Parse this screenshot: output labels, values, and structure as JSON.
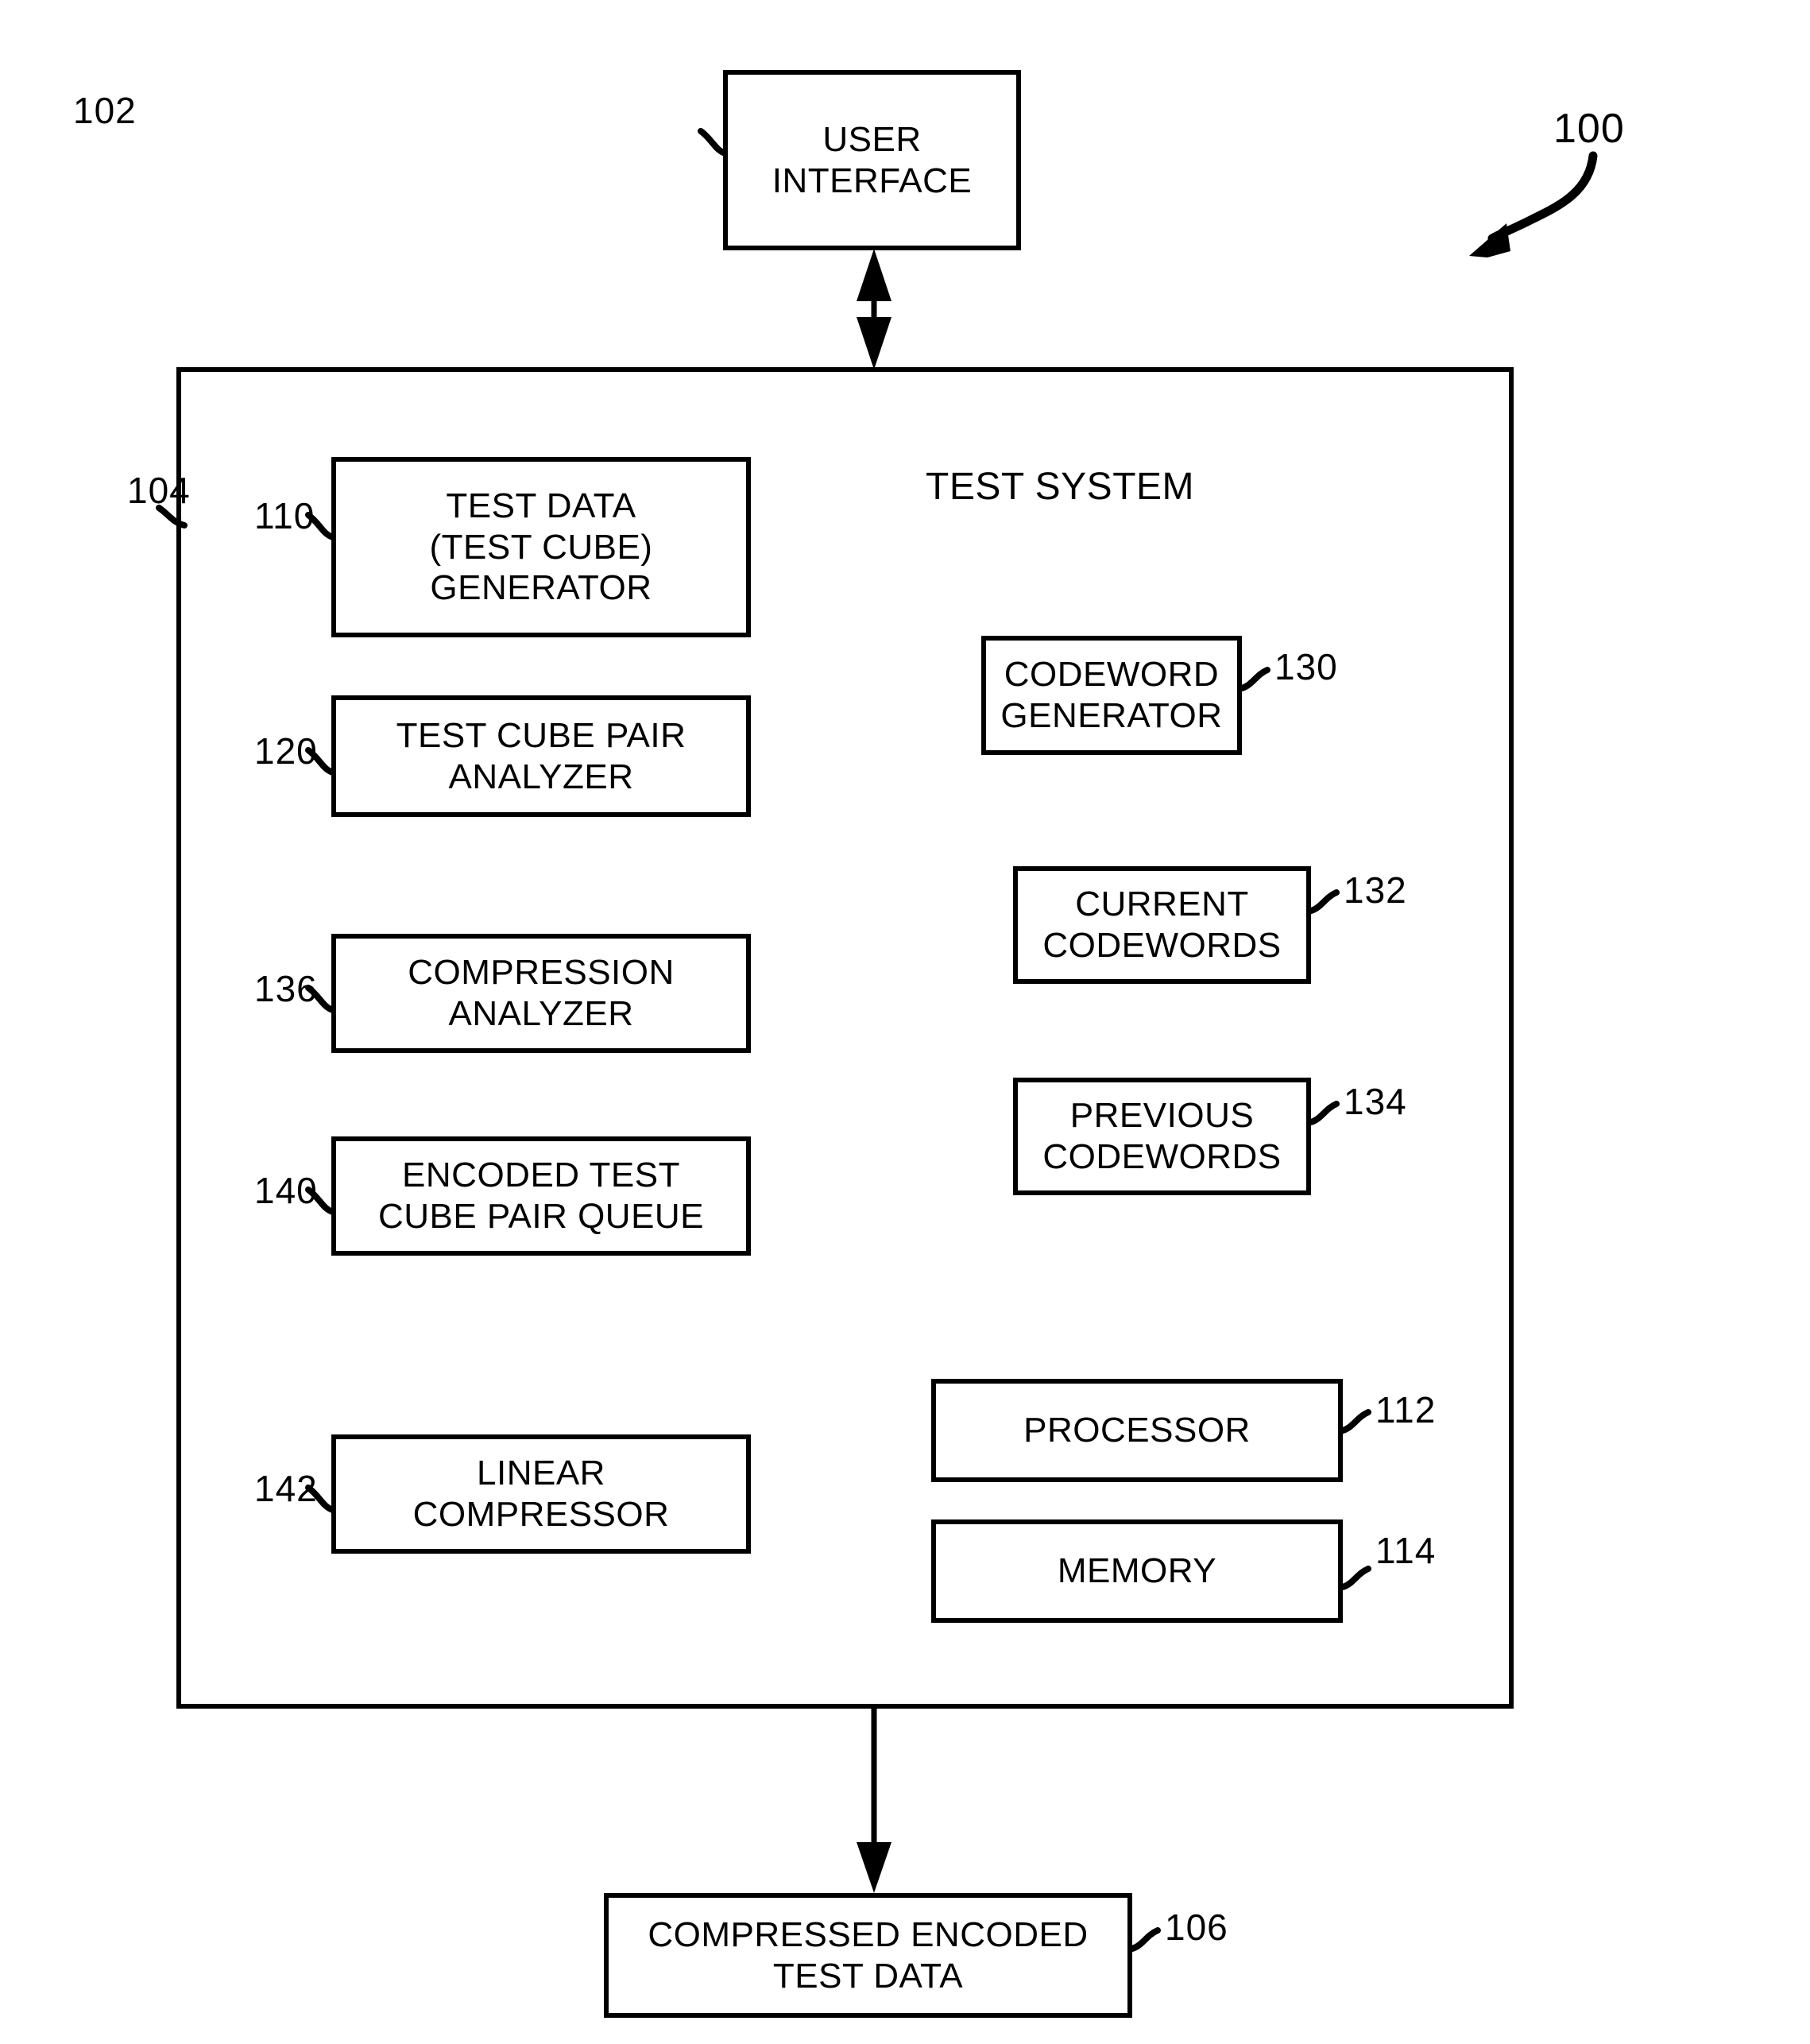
{
  "figure": {
    "system_ref": "100",
    "system_label": "TEST SYSTEM"
  },
  "nodes": {
    "user_interface": {
      "ref": "102",
      "lines": [
        "USER",
        "INTERFACE"
      ]
    },
    "test_system": {
      "ref": "104",
      "title": "TEST SYSTEM"
    },
    "test_data_generator": {
      "ref": "110",
      "lines": [
        "TEST DATA",
        "(TEST CUBE)",
        "GENERATOR"
      ]
    },
    "test_cube_pair_analyzer": {
      "ref": "120",
      "lines": [
        "TEST CUBE PAIR",
        "ANALYZER"
      ]
    },
    "compression_analyzer": {
      "ref": "136",
      "lines": [
        "COMPRESSION",
        "ANALYZER"
      ]
    },
    "encoded_test_cube_pair_queue": {
      "ref": "140",
      "lines": [
        "ENCODED TEST",
        "CUBE PAIR QUEUE"
      ]
    },
    "linear_compressor": {
      "ref": "142",
      "lines": [
        "LINEAR",
        "COMPRESSOR"
      ]
    },
    "codeword_generator": {
      "ref": "130",
      "lines": [
        "CODEWORD",
        "GENERATOR"
      ]
    },
    "current_codewords": {
      "ref": "132",
      "lines": [
        "CURRENT",
        "CODEWORDS"
      ]
    },
    "previous_codewords": {
      "ref": "134",
      "lines": [
        "PREVIOUS",
        "CODEWORDS"
      ]
    },
    "processor": {
      "ref": "112",
      "lines": [
        "PROCESSOR"
      ]
    },
    "memory": {
      "ref": "114",
      "lines": [
        "MEMORY"
      ]
    },
    "compressed_encoded_test_data": {
      "ref": "106",
      "lines": [
        "COMPRESSED ENCODED",
        "TEST DATA"
      ]
    }
  },
  "colors": {
    "stroke": "#000000",
    "background": "#ffffff"
  }
}
